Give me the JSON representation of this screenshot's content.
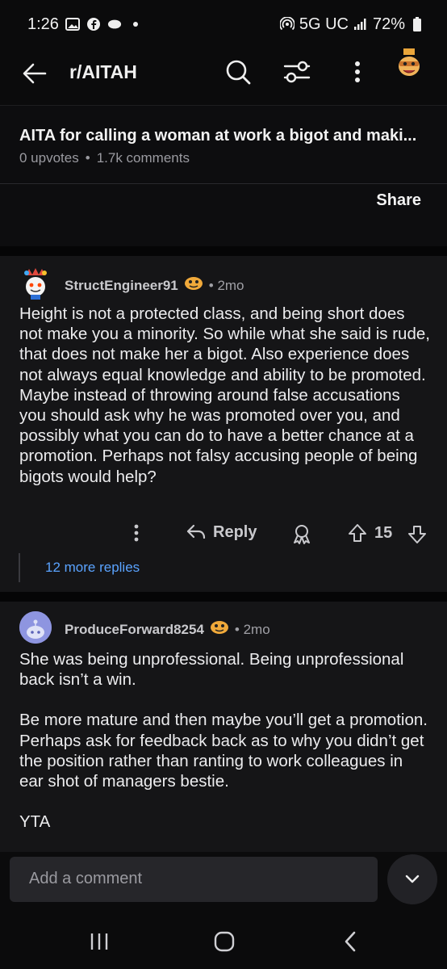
{
  "status_bar": {
    "time": "1:26",
    "network": "5G UC",
    "battery": "72%"
  },
  "app_bar": {
    "subreddit": "r/AITAH"
  },
  "post": {
    "title": "AITA for calling a woman at work a bigot and maki...",
    "upvotes": "0 upvotes",
    "separator": "•",
    "comments": "1.7k comments",
    "share_label": "Share"
  },
  "comments": [
    {
      "username": "StructEngineer91",
      "age": "• 2mo",
      "body": "Height is not a protected class, and being short does not make you a minority. So while what she said is rude, that does not make her a bigot. Also experience does not always equal knowledge and ability to be promoted. Maybe instead of throwing around false accusations you should ask why he was promoted over you, and possibly what you can do to have a better chance at a promotion. Perhaps not falsy accusing people of being bigots would help?",
      "reply_label": "Reply",
      "score": "15",
      "more_replies": "12 more replies"
    },
    {
      "username": "ProduceForward8254",
      "age": "• 2mo",
      "body_p1": "She was being unprofessional. Being unprofessional back isn’t a win.",
      "body_p2": "Be more mature and then maybe you’ll get a promotion. Perhaps ask for feedback back as to why you didn’t get the position rather than ranting to work colleagues in ear shot of managers bestie.",
      "body_p3": "YTA"
    }
  ],
  "composer": {
    "placeholder": "Add a comment"
  },
  "colors": {
    "link": "#5aa3ff",
    "background": "#0b0b0c",
    "card": "#151517"
  }
}
